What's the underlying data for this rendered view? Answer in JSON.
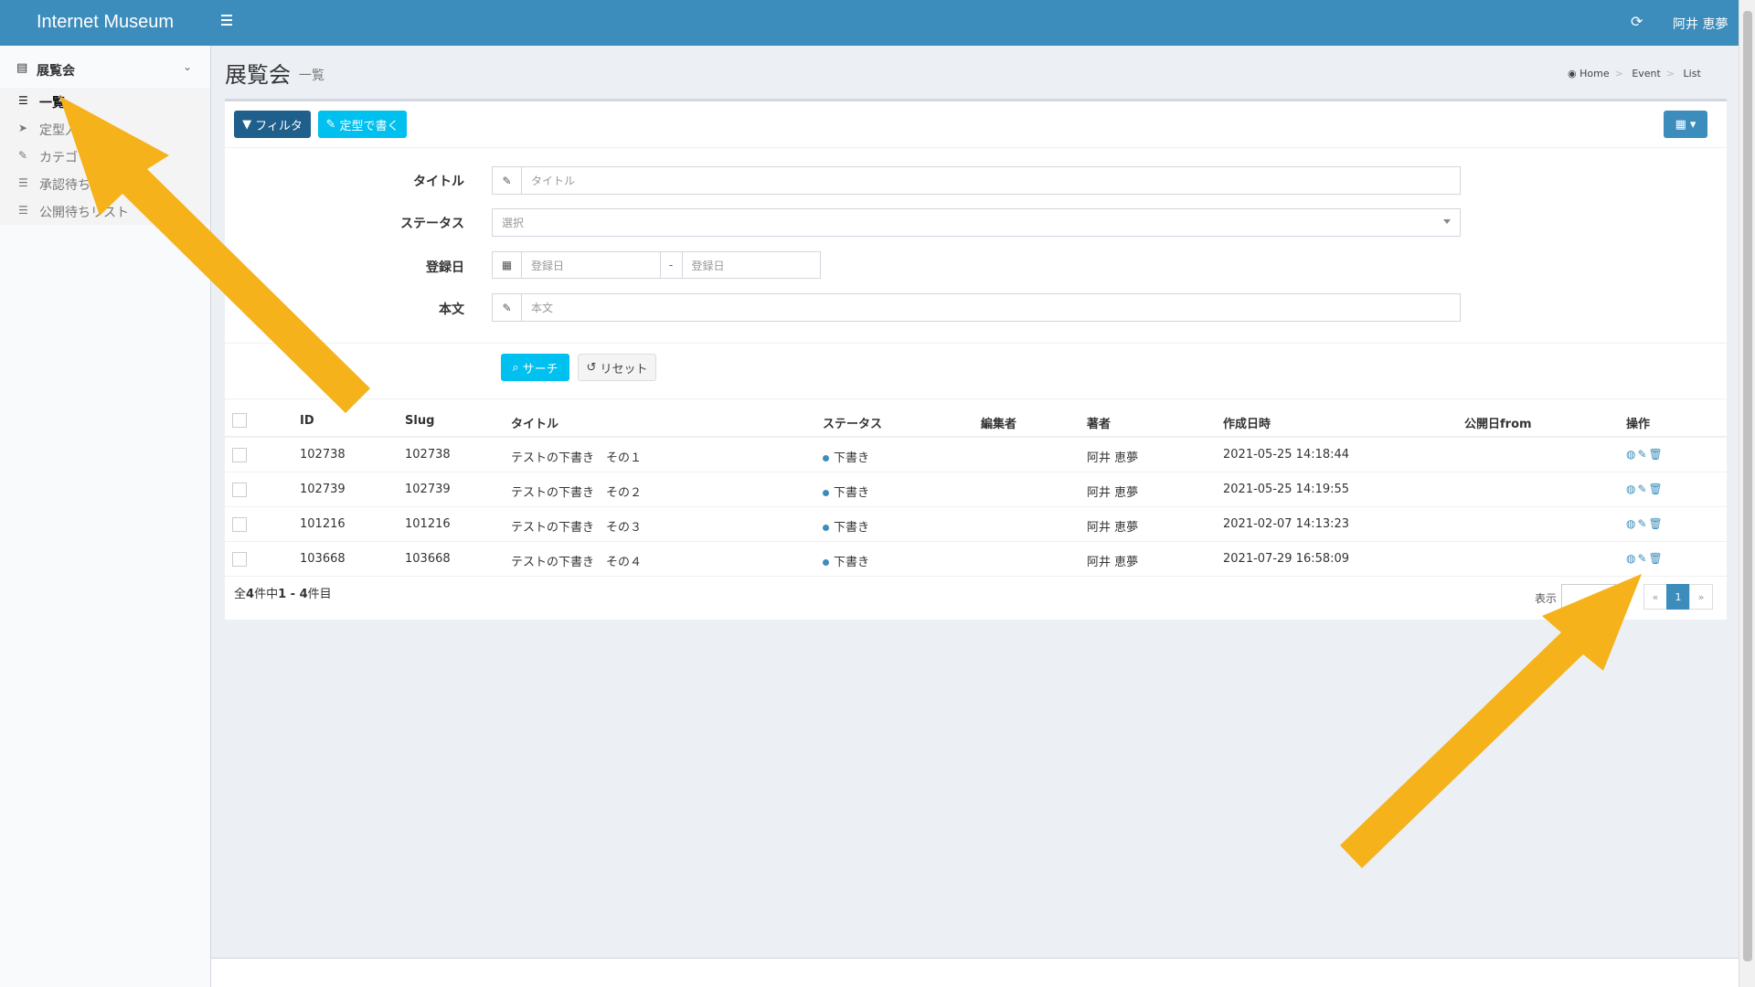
{
  "app": {
    "brand": "Internet Museum",
    "user": "阿井 恵夢"
  },
  "icons": {
    "menu": "hamburger-icon",
    "refresh": "refresh-icon"
  },
  "sidebar": {
    "section_label": "展覧会",
    "items": [
      {
        "label": "一覧",
        "icon": "list-icon",
        "active": true
      },
      {
        "label": "定型入",
        "icon": "send-icon"
      },
      {
        "label": "カテゴリ",
        "icon": "pencil-icon"
      },
      {
        "label": "承認待ち",
        "icon": "list-icon"
      },
      {
        "label": "公開待ちリスト",
        "icon": "list-icon"
      }
    ]
  },
  "header": {
    "title": "展覧会",
    "subtitle": "一覧",
    "breadcrumb": [
      "Home",
      "Event",
      "List"
    ]
  },
  "toolbar": {
    "filter_label": "フィルタ",
    "template_label": "定型で書く"
  },
  "filter": {
    "title_label": "タイトル",
    "title_placeholder": "タイトル",
    "status_label": "ステータス",
    "status_value": "選択",
    "date_label": "登録日",
    "date_from_placeholder": "登録日",
    "date_sep": "-",
    "date_to_placeholder": "登録日",
    "body_label": "本文",
    "body_placeholder": "本文",
    "search_label": "サーチ",
    "reset_label": "リセット"
  },
  "table": {
    "headers": {
      "id": "ID",
      "slug": "Slug",
      "title": "タイトル",
      "status": "ステータス",
      "editor": "編集者",
      "author": "著者",
      "created": "作成日時",
      "publish_from": "公開日from",
      "actions": "操作"
    },
    "rows": [
      {
        "id": "102738",
        "slug": "102738",
        "title": "テストの下書き　その１",
        "status": "下書き",
        "author": "阿井 恵夢",
        "created": "2021-05-25 14:18:44"
      },
      {
        "id": "102739",
        "slug": "102739",
        "title": "テストの下書き　その２",
        "status": "下書き",
        "author": "阿井 恵夢",
        "created": "2021-05-25 14:19:55"
      },
      {
        "id": "101216",
        "slug": "101216",
        "title": "テストの下書き　その３",
        "status": "下書き",
        "author": "阿井 恵夢",
        "created": "2021-02-07 14:13:23"
      },
      {
        "id": "103668",
        "slug": "103668",
        "title": "テストの下書き　その４",
        "status": "下書き",
        "author": "阿井 恵夢",
        "created": "2021-07-29 16:58:09"
      }
    ]
  },
  "pagination": {
    "summary_prefix": "全",
    "total": "4",
    "summary_mid": "件中",
    "range": "1 - 4",
    "summary_suffix": "件目",
    "show_label": "表示",
    "prev": "«",
    "page": "1",
    "next": "»"
  },
  "colors": {
    "topbar": "#3c8dbc",
    "accent_cyan": "#00c0ef",
    "annotation_arrow": "#f5b21b"
  }
}
